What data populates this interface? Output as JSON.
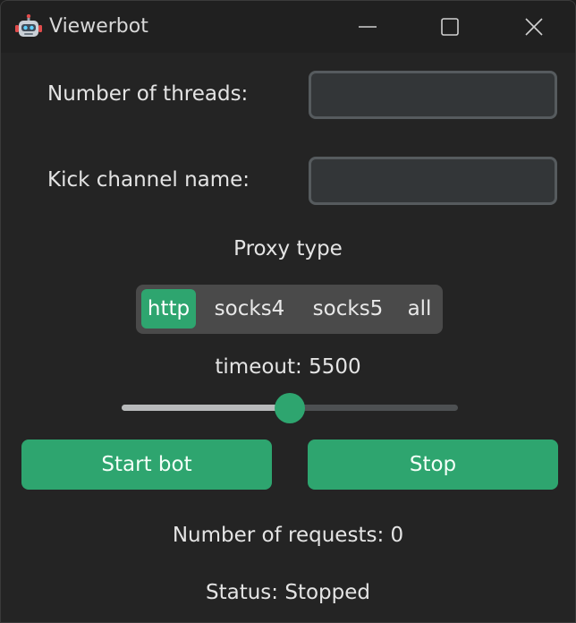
{
  "window": {
    "title": "Viewerbot",
    "icon": "robot-icon"
  },
  "form": {
    "threads_label": "Number of threads:",
    "threads_value": "",
    "channel_label": "Kick channel name:",
    "channel_value": ""
  },
  "proxy": {
    "label": "Proxy type",
    "options": [
      "http",
      "socks4",
      "socks5",
      "all"
    ],
    "selected": "http"
  },
  "timeout": {
    "label": "timeout: 5500",
    "value": 5500,
    "fraction": 0.5
  },
  "buttons": {
    "start": "Start bot",
    "stop": "Stop"
  },
  "stats": {
    "requests": "Number of requests: 0",
    "status": "Status: Stopped"
  },
  "colors": {
    "accent": "#2ea56f",
    "background": "#242424",
    "entry_bg": "#333638"
  }
}
